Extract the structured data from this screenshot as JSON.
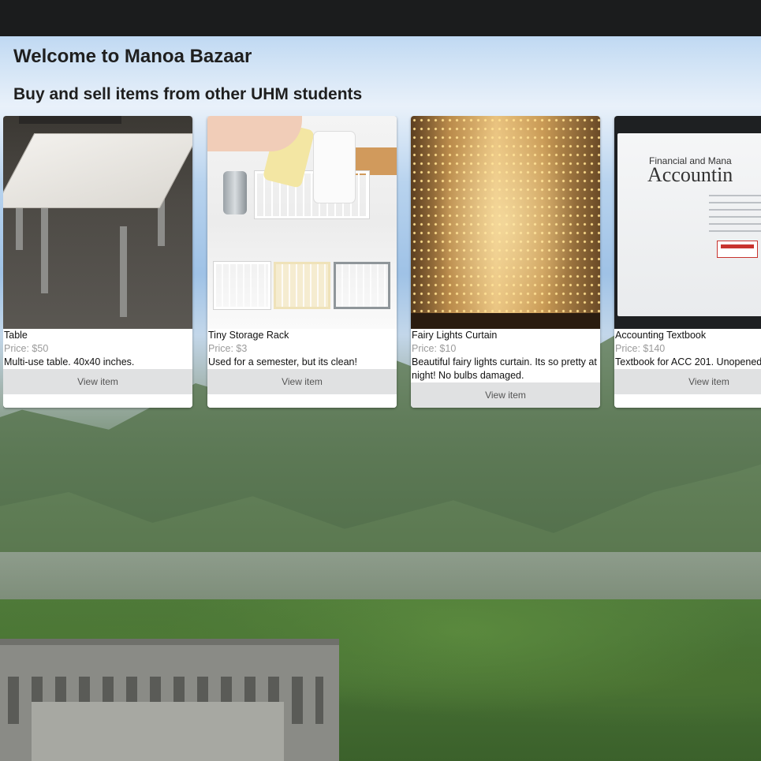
{
  "header": {
    "title": "Welcome to Manoa Bazaar",
    "subtitle": "Buy and sell items from other UHM students"
  },
  "items": [
    {
      "name": "Table",
      "price": "Price: $50",
      "description": "Multi-use table. 40x40 inches.",
      "button_label": "View item",
      "image_icon": "table-photo"
    },
    {
      "name": "Tiny Storage Rack",
      "price": "Price: $3",
      "description": "Used for a semester, but its clean!",
      "button_label": "View item",
      "image_icon": "storage-rack-photo"
    },
    {
      "name": "Fairy Lights Curtain",
      "price": "Price: $10",
      "description": "Beautiful fairy lights curtain. Its so pretty at night! No bulbs damaged.",
      "button_label": "View item",
      "image_icon": "fairy-lights-photo"
    },
    {
      "name": "Accounting Textbook",
      "price": "Price: $140",
      "description": "Textbook for ACC 201. Unopened.",
      "button_label": "View item",
      "image_icon": "textbook-photo",
      "cover_text_small": "Financial and Mana",
      "cover_text_large": "Accountin"
    }
  ],
  "colors": {
    "navbar": "#1b1c1d",
    "button_bg": "#e0e1e2",
    "price_text": "#9a9a9a"
  }
}
